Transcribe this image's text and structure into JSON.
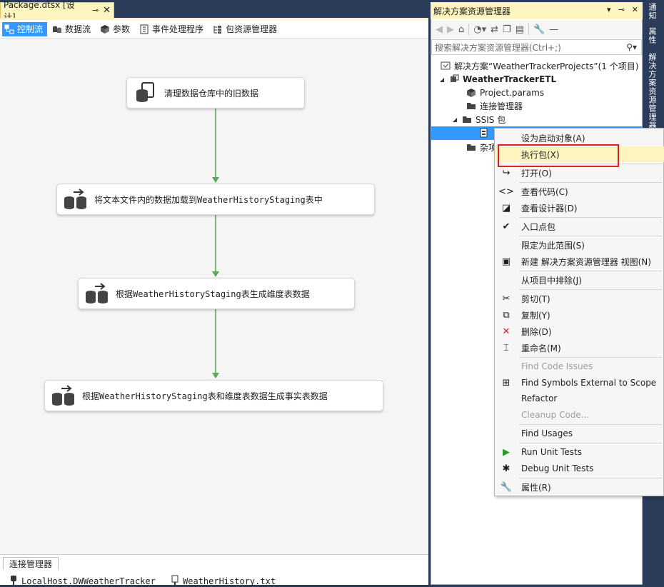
{
  "doc_tab": {
    "title": "Package.dtsx [设计]",
    "pin": "⊸",
    "close": "✕"
  },
  "designer_tabs": [
    {
      "label": "控制流",
      "icon": "control-flow-icon",
      "active": true
    },
    {
      "label": "数据流",
      "icon": "data-flow-icon",
      "active": false
    },
    {
      "label": "参数",
      "icon": "parameters-icon",
      "active": false
    },
    {
      "label": "事件处理程序",
      "icon": "event-handlers-icon",
      "active": false
    },
    {
      "label": "包资源管理器",
      "icon": "package-explorer-icon",
      "active": false
    }
  ],
  "tasks": [
    {
      "label": "清理数据仓库中的旧数据",
      "icon": "execute-sql-task-icon"
    },
    {
      "label": "将文本文件内的数据加载到WeatherHistoryStaging表中",
      "icon": "data-flow-task-icon"
    },
    {
      "label": "根据WeatherHistoryStaging表生成维度表数据",
      "icon": "data-flow-task-icon"
    },
    {
      "label": "根据WeatherHistoryStaging表和维度表数据生成事实表数据",
      "icon": "data-flow-task-icon"
    }
  ],
  "connection_manager": {
    "tab_label": "连接管理器",
    "items": [
      {
        "label": "LocalHost.DWWeatherTracker",
        "icon": "oledb-connection-icon"
      },
      {
        "label": "WeatherHistory.txt",
        "icon": "flat-file-connection-icon"
      }
    ]
  },
  "solution_explorer": {
    "title": "解决方案资源管理器",
    "title_buttons": [
      "▾",
      "⊸",
      "✕"
    ],
    "search_placeholder": "搜索解决方案资源管理器(Ctrl+;)",
    "search_icon": "search-icon",
    "tree": [
      {
        "label": "解决方案“WeatherTrackerProjects”(1 个项目)",
        "icon": "solution-icon"
      },
      {
        "label": "WeatherTrackerETL",
        "icon": "project-icon",
        "bold": true
      },
      {
        "label": "Project.params",
        "icon": "params-icon"
      },
      {
        "label": "连接管理器",
        "icon": "folder-icon"
      },
      {
        "label": "SSIS 包",
        "icon": "folder-icon"
      },
      {
        "label": "",
        "icon": "package-icon",
        "selected": true
      },
      {
        "label": "杂项",
        "icon": "folder-icon"
      }
    ]
  },
  "side_strip": [
    "通知",
    "属性",
    "解决方案资源管理器"
  ],
  "context_menu": {
    "items": [
      {
        "label": "设为启动对象(A)",
        "icon": ""
      },
      {
        "label": "执行包(X)",
        "icon": "",
        "highlighted": true
      },
      {
        "label": "打开(O)",
        "icon": "open-icon"
      },
      {
        "label": "查看代码(C)",
        "icon": "view-code-icon"
      },
      {
        "label": "查看设计器(D)",
        "icon": "view-designer-icon"
      },
      {
        "label": "入口点包",
        "icon": "checkmark-icon"
      },
      {
        "label": "限定为此范围(S)",
        "icon": ""
      },
      {
        "label": "新建 解决方案资源管理器 视图(N)",
        "icon": "new-view-icon"
      },
      {
        "label": "从项目中排除(J)",
        "icon": ""
      },
      {
        "label": "剪切(T)",
        "icon": "cut-icon"
      },
      {
        "label": "复制(Y)",
        "icon": "copy-icon"
      },
      {
        "label": "删除(D)",
        "icon": "delete-icon"
      },
      {
        "label": "重命名(M)",
        "icon": "rename-icon"
      },
      {
        "label": "Find Code Issues",
        "icon": "",
        "disabled": true
      },
      {
        "label": "Find Symbols External to Scope",
        "icon": "find-symbols-icon"
      },
      {
        "label": "Refactor",
        "icon": ""
      },
      {
        "label": "Cleanup Code...",
        "icon": "",
        "disabled": true
      },
      {
        "label": "Find Usages",
        "icon": ""
      },
      {
        "label": "Run Unit Tests",
        "icon": "run-tests-icon"
      },
      {
        "label": "Debug Unit Tests",
        "icon": "debug-tests-icon"
      },
      {
        "label": "属性(R)",
        "icon": "properties-icon"
      }
    ]
  },
  "colors": {
    "accent": "#3399ff",
    "highlight": "#fdf4bf",
    "flow_arrow": "#5aa85a",
    "delete_red": "#d42020",
    "annotation_red": "#e02020"
  }
}
